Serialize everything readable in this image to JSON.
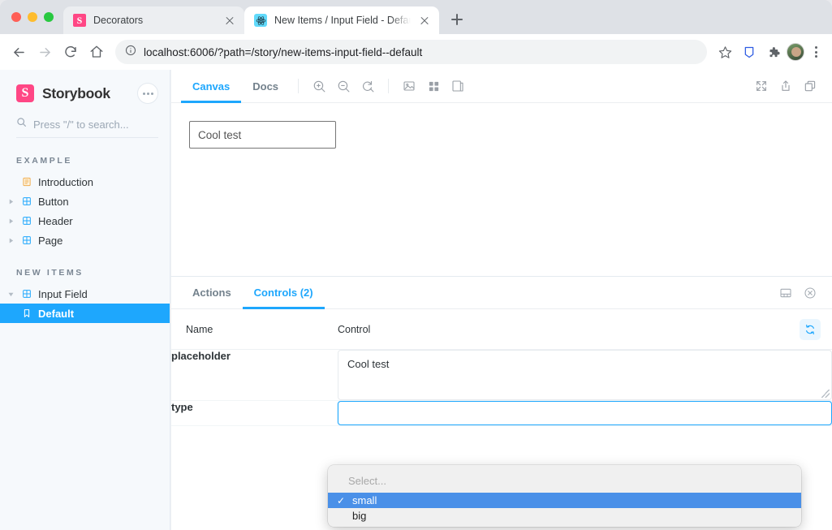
{
  "browser": {
    "tabs": [
      {
        "title": "Decorators",
        "favicon": "storybook-icon",
        "active": false
      },
      {
        "title": "New Items / Input Field - Default",
        "favicon": "react-icon",
        "active": true
      }
    ],
    "new_tab_label": "+",
    "url": "localhost:6006/?path=/story/new-items-input-field--default",
    "nav": {
      "back": "←",
      "forward": "→",
      "reload": "↻",
      "home": "⌂"
    }
  },
  "sidebar": {
    "brand": "Storybook",
    "menu_label": "•••",
    "search_placeholder": "Press \"/\" to search...",
    "sections": [
      {
        "title": "EXAMPLE",
        "items": [
          {
            "label": "Introduction",
            "icon": "document-icon",
            "expandable": false,
            "selected": false
          },
          {
            "label": "Button",
            "icon": "component-icon",
            "expandable": true,
            "selected": false
          },
          {
            "label": "Header",
            "icon": "component-icon",
            "expandable": true,
            "selected": false
          },
          {
            "label": "Page",
            "icon": "component-icon",
            "expandable": true,
            "selected": false
          }
        ]
      },
      {
        "title": "NEW ITEMS",
        "items": [
          {
            "label": "Input Field",
            "icon": "component-icon",
            "expandable": true,
            "expanded": true,
            "selected": false
          },
          {
            "label": "Default",
            "icon": "story-icon",
            "expandable": false,
            "selected": true,
            "child": true
          }
        ]
      }
    ]
  },
  "preview": {
    "tabs": [
      {
        "label": "Canvas",
        "active": true
      },
      {
        "label": "Docs",
        "active": false
      }
    ],
    "tools": [
      "zoom-in-icon",
      "zoom-out-icon",
      "zoom-reset-icon",
      "background-icon",
      "grid-icon",
      "measure-icon"
    ],
    "right_tools": [
      "fullscreen-icon",
      "share-icon",
      "copy-icon"
    ],
    "story": {
      "input_text": "Cool test"
    }
  },
  "addon_panel": {
    "tabs": [
      {
        "label": "Actions",
        "active": false
      },
      {
        "label": "Controls (2)",
        "active": true
      }
    ],
    "right_tools": [
      "panel-position-icon",
      "close-panel-icon"
    ],
    "table": {
      "headers": {
        "name": "Name",
        "control": "Control"
      },
      "reset_label": "reset-icon",
      "rows": [
        {
          "name": "placeholder",
          "control_type": "textarea",
          "value": "Cool test"
        },
        {
          "name": "type",
          "control_type": "select",
          "value": "small"
        }
      ]
    }
  },
  "select_popup": {
    "placeholder": "Select...",
    "options": [
      {
        "label": "small",
        "selected": true
      },
      {
        "label": "big",
        "selected": false
      }
    ],
    "check_glyph": "✓"
  },
  "colors": {
    "accent": "#1ea7fd",
    "brand_pink": "#ff4785",
    "selection_blue": "#4a90e8"
  }
}
